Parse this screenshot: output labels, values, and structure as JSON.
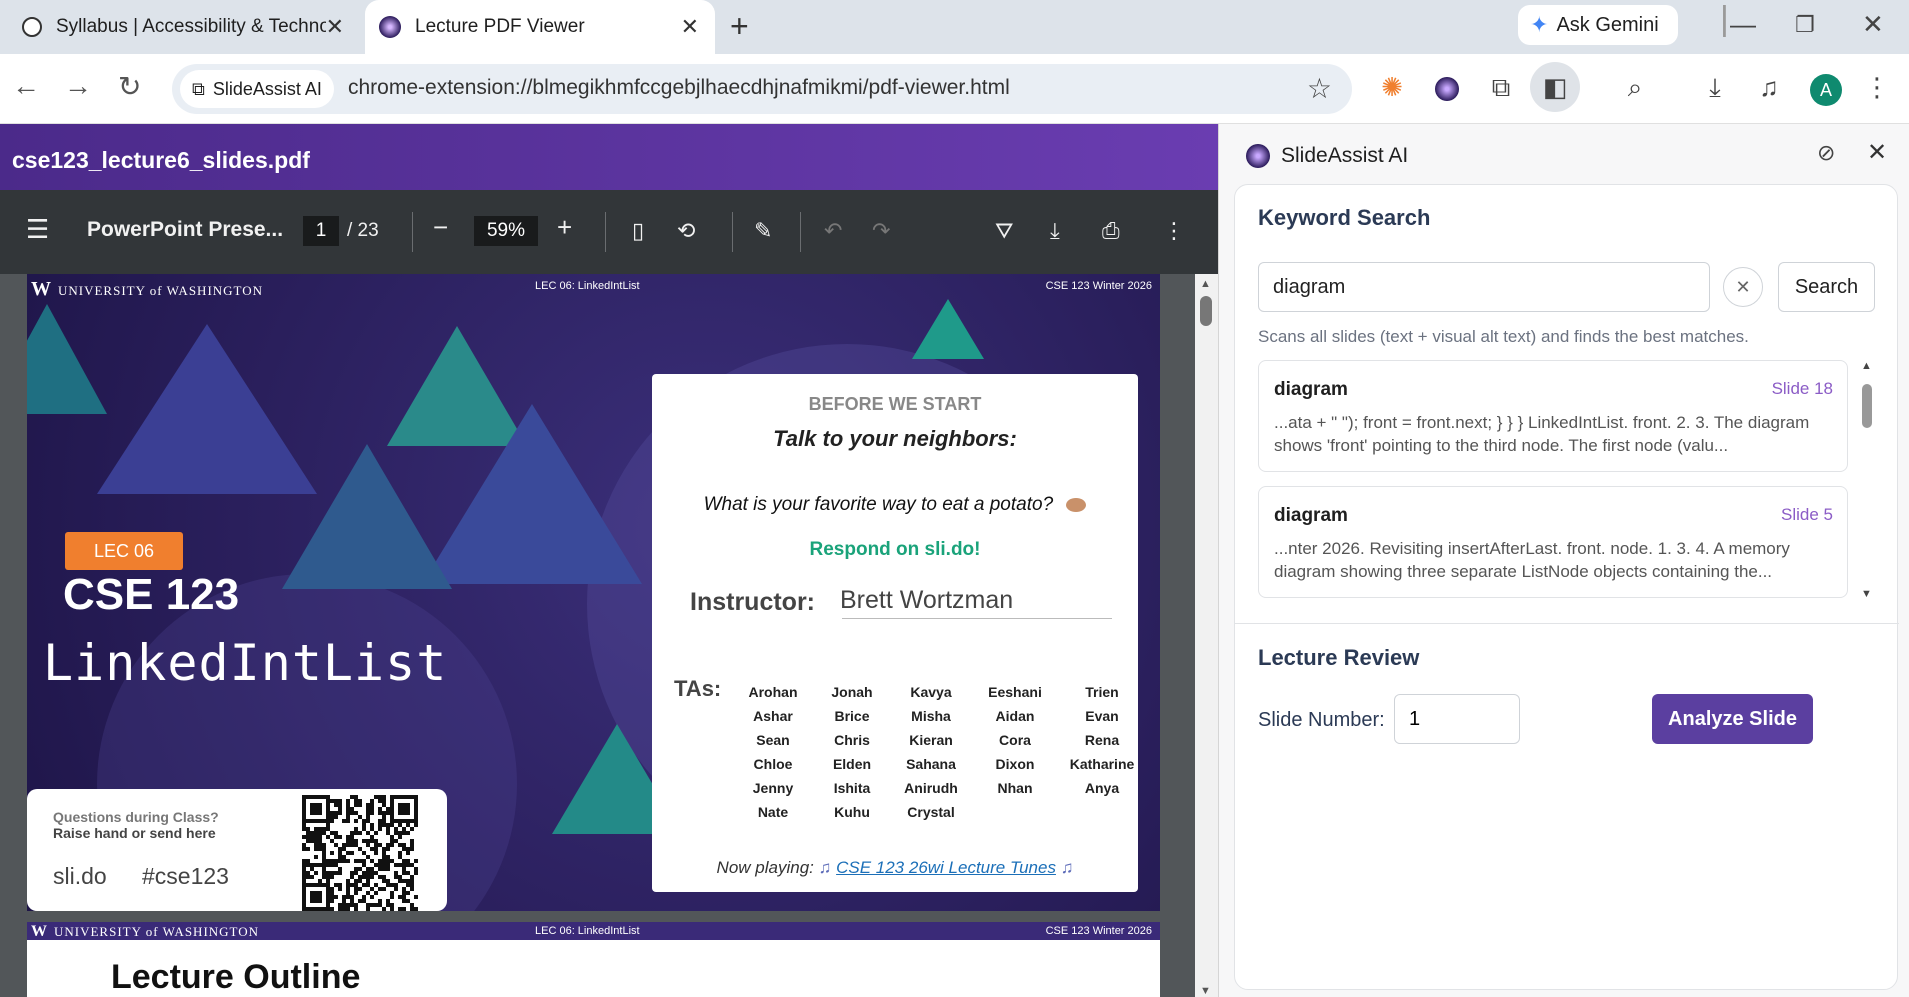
{
  "browser": {
    "tabs": [
      {
        "title": "Syllabus | Accessibility & Techno",
        "favicon": "accessibility-icon"
      },
      {
        "title": "Lecture PDF Viewer",
        "favicon": "slideassist-icon"
      }
    ],
    "ask_gemini": "Ask Gemini",
    "omnibox": {
      "chip": "SlideAssist AI",
      "url": "chrome-extension://blmegikhmfccgebjlhaecdhjnafmikmi/pdf-viewer.html"
    },
    "avatar_letter": "A"
  },
  "pdf": {
    "filename": "cse123_lecture6_slides.pdf",
    "doc_title": "PowerPoint Prese...",
    "page_current": "1",
    "page_total": "/ 23",
    "zoom": "59%"
  },
  "slide1": {
    "uw_logo": "W",
    "uw_name": "UNIVERSITY of WASHINGTON",
    "header_center": "LEC 06: LinkedIntList",
    "header_right": "CSE 123 Winter 2026",
    "badge": "LEC 06",
    "course": "CSE 123",
    "topic": "LinkedIntList",
    "questions_line1": "Questions during Class?",
    "questions_line2": "Raise hand or send here",
    "slido": "sli.do",
    "hashtag": "#cse123",
    "card": {
      "before": "BEFORE WE START",
      "talk": "Talk to your neighbors:",
      "question": "What is your favorite way to eat a potato?",
      "respond": "Respond on sli.do!",
      "instructor_label": "Instructor:",
      "instructor_name": "Brett Wortzman",
      "tas_label": "TAs:",
      "tas": [
        "Arohan",
        "Jonah",
        "Kavya",
        "Eeshani",
        "Trien",
        "Ashar",
        "Brice",
        "Misha",
        "Aidan",
        "Evan",
        "Sean",
        "Chris",
        "Kieran",
        "Cora",
        "Rena",
        "Chloe",
        "Elden",
        "Sahana",
        "Dixon",
        "Katharine",
        "Jenny",
        "Ishita",
        "Anirudh",
        "Nhan",
        "Anya",
        "Nate",
        "Kuhu",
        "Crystal"
      ],
      "now_playing_label": "Now playing:",
      "now_playing_link": "CSE 123 26wi Lecture Tunes"
    }
  },
  "slide2": {
    "uw_logo": "W",
    "uw_name": "UNIVERSITY of WASHINGTON",
    "header_center": "LEC 06: LinkedIntList",
    "header_right": "CSE 123 Winter 2026",
    "title": "Lecture Outline"
  },
  "sidepanel": {
    "title": "SlideAssist AI",
    "keyword_heading": "Keyword Search",
    "search_value": "diagram",
    "clear": "✕",
    "search_button": "Search",
    "help": "Scans all slides (text + visual alt text) and finds the best matches.",
    "results": [
      {
        "keyword": "diagram",
        "slide": "Slide 18",
        "snippet": "...ata + \" \"); front = front.next; } } } LinkedIntList. front. 2. 3. The diagram shows 'front' pointing to the third node. The first node (valu..."
      },
      {
        "keyword": "diagram",
        "slide": "Slide 5",
        "snippet": "...nter 2026. Revisiting insertAfterLast. front. node. 1. 3. 4. A memory diagram showing three separate ListNode objects containing the..."
      }
    ],
    "review_heading": "Lecture Review",
    "slide_number_label": "Slide Number:",
    "slide_number_value": "1",
    "analyze_button": "Analyze Slide"
  }
}
